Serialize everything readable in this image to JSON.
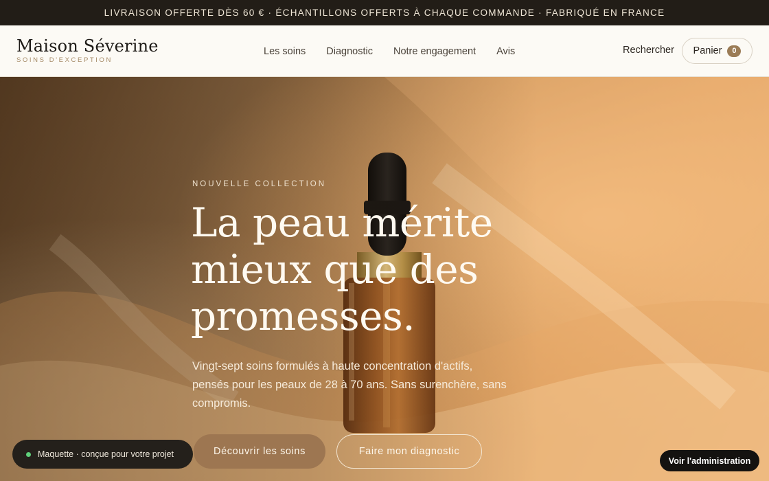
{
  "announcement": "LIVRAISON OFFERTE DÈS 60 € · ÉCHANTILLONS OFFERTS À CHAQUE COMMANDE · FABRIQUÉ EN FRANCE",
  "brand": {
    "name": "Maison Séverine",
    "tagline": "SOINS D'EXCEPTION"
  },
  "nav": {
    "items": [
      {
        "label": "Les soins"
      },
      {
        "label": "Diagnostic"
      },
      {
        "label": "Notre engagement"
      },
      {
        "label": "Avis"
      }
    ]
  },
  "header_actions": {
    "search_label": "Rechercher",
    "cart_label": "Panier",
    "cart_count": "0"
  },
  "hero": {
    "eyebrow": "NOUVELLE COLLECTION",
    "headline": "La peau mérite mieux que des promesses.",
    "lede": "Vingt-sept soins formulés à haute concentration d'actifs, pensés pour les peaux de 28 à 70 ans. Sans surenchère, sans compromis.",
    "primary_cta": "Découvrir les soins",
    "secondary_cta": "Faire mon diagnostic"
  },
  "prototype_badge": {
    "text": "Maquette · conçue pour votre projet",
    "status_color": "#5fd07b"
  },
  "admin_button": "Voir l'administration",
  "colors": {
    "accent": "#9d7651",
    "announcement_bg": "#221d17",
    "header_bg": "#fcfaf5"
  }
}
